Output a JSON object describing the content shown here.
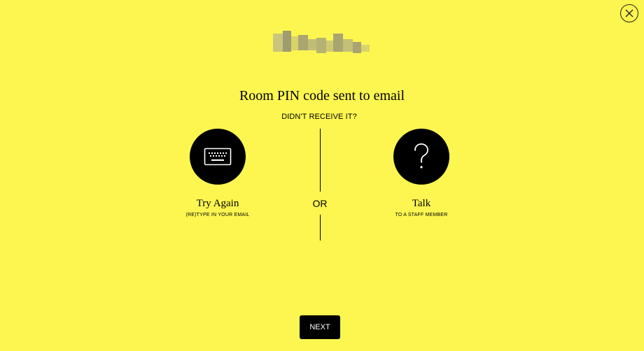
{
  "colors": {
    "background": "#fdf650",
    "foreground": "#000000",
    "button_text": "#ffffff"
  },
  "header": {
    "close_icon": "close-icon",
    "logo": "blurred-logo"
  },
  "main": {
    "title": "Room PIN code sent to email",
    "subtitle": "DIDN'T RECEIVE IT?",
    "options": [
      {
        "icon": "keyboard-icon",
        "label": "Try Again",
        "sublabel": "(RE)TYPE IN YOUR EMAIL"
      },
      {
        "icon": "question-mark-icon",
        "label": "Talk",
        "sublabel": "TO A STAFF MEMBER"
      }
    ],
    "separator_text": "OR"
  },
  "footer": {
    "next_label": "NEXT"
  }
}
